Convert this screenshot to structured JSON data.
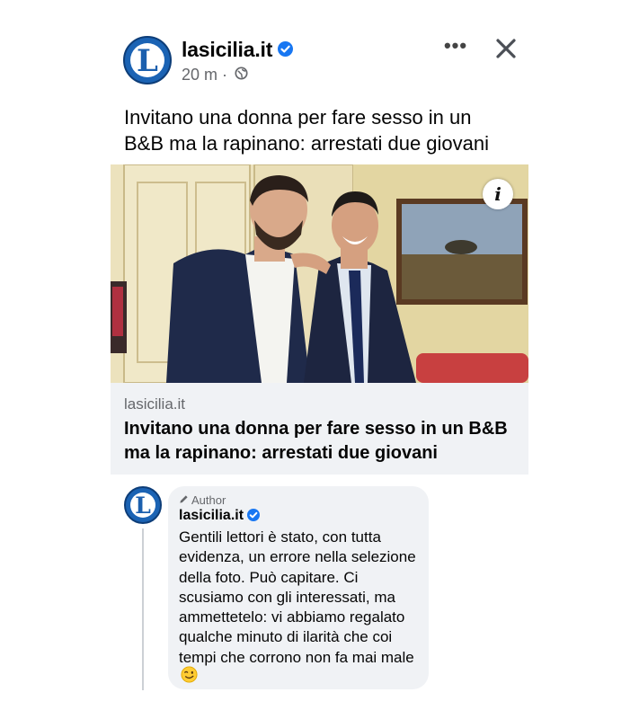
{
  "post": {
    "page_name": "lasicilia.it",
    "time": "20 m",
    "separator": "·",
    "more_label": "•••",
    "text": "Invitano una donna per fare sesso in un B&B ma la rapinano: arrestati due giovani"
  },
  "link_preview": {
    "domain": "lasicilia.it",
    "title": "Invitano una donna per fare sesso in un B&B ma la rapinano: arrestati due giovani",
    "info_label": "i"
  },
  "comment": {
    "badge": "Author",
    "name": "lasicilia.it",
    "text": "Gentili lettori è stato, con tutta evidenza, un errore nella selezione della foto. Può capitare. Ci scusiamo con gli interessati, ma ammettetelo: vi abbiamo regalato qualche minuto di ilarità che coi tempi che corrono non fa mai male"
  },
  "logo": {
    "letter": "L"
  },
  "icons": {
    "verified": "verified-badge-icon",
    "globe": "globe-icon",
    "close": "close-icon",
    "pencil": "pencil-icon",
    "emoji": "winking-face-icon"
  },
  "colors": {
    "brand_blue": "#1b63b4",
    "verified_blue": "#1877f2",
    "meta_gray": "#65676b",
    "preview_bg": "#f0f2f5"
  }
}
